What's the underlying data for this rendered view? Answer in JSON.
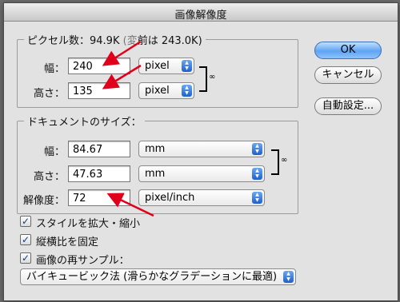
{
  "window": {
    "title": "画像解像度"
  },
  "pixel_dimensions": {
    "label_prefix": "ピクセル数：94.9K",
    "label_covered": "(変",
    "label_rest": "前は 243.0K)",
    "width": {
      "label": "幅：",
      "value": "240",
      "unit": "pixel"
    },
    "height": {
      "label": "高さ：",
      "value": "135",
      "unit": "pixel"
    }
  },
  "document_size": {
    "label": "ドキュメントのサイズ：",
    "width": {
      "label": "幅：",
      "value": "84.67",
      "unit": "mm"
    },
    "height": {
      "label": "高さ：",
      "value": "47.63",
      "unit": "mm"
    },
    "resolution": {
      "label": "解像度：",
      "value": "72",
      "unit": "pixel/inch"
    }
  },
  "buttons": {
    "ok": "OK",
    "cancel": "キャンセル",
    "auto": "自動設定..."
  },
  "checkboxes": [
    {
      "label": "スタイルを拡大・縮小",
      "checked": true
    },
    {
      "label": "縦横比を固定",
      "checked": true
    },
    {
      "label": "画像の再サンプル：",
      "checked": true
    }
  ],
  "resample_method": "バイキュービック法 (滑らかなグラデーションに最適)",
  "icons": {
    "chain": "chain-link-icon",
    "stepper": "popup-arrows-icon",
    "check": "checkmark-icon"
  },
  "colors": {
    "annotation_arrow": "#e0001b",
    "default_button": "#5fa4f2"
  }
}
